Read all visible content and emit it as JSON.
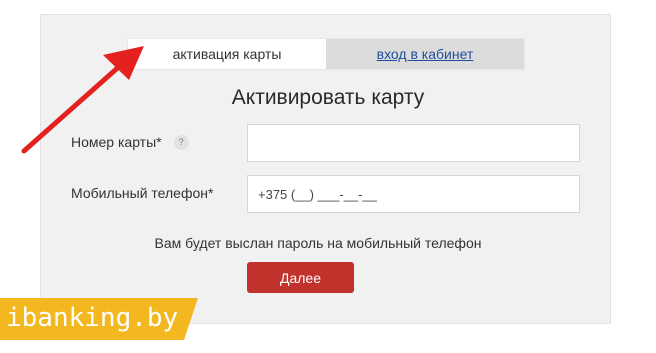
{
  "tabs": {
    "activate": "активация карты",
    "login": "вход в кабинет"
  },
  "form": {
    "title": "Активировать карту",
    "card_number_label": "Номер карты*",
    "help_icon_text": "?",
    "phone_label": "Мобильный телефон*",
    "card_number_value": "",
    "phone_placeholder": "+375 (__) ___-__-__",
    "notice": "Вам будет выслан пароль на мобильный телефон",
    "submit_label": "Далее"
  },
  "watermark": {
    "text": "ibanking.by"
  },
  "colors": {
    "accent_red": "#c0322b",
    "arrow_red": "#e4211e",
    "brand_yellow": "#f3b81f",
    "link_blue": "#1f4f9c"
  },
  "icons": {
    "help": "question-mark-icon",
    "annotation": "red-arrow-icon"
  }
}
